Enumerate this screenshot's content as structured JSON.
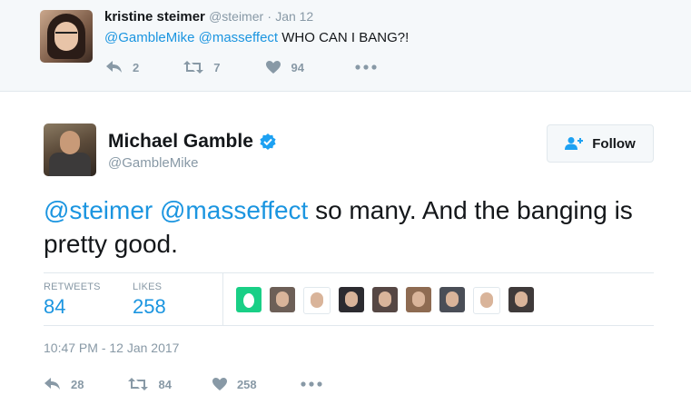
{
  "parent_tweet": {
    "name": "kristine steimer",
    "handle": "@steimer",
    "separator": "·",
    "date": "Jan 12",
    "mention1": "@GambleMike",
    "mention2": "@masseffect",
    "text": "WHO CAN I BANG?!",
    "replies": "2",
    "retweets": "7",
    "likes": "94"
  },
  "tweet": {
    "name": "Michael Gamble",
    "handle": "@GambleMike",
    "follow_label": "Follow",
    "mention1": "@steimer",
    "mention2": "@masseffect",
    "text": "so many. And the banging is pretty good.",
    "retweets_label": "RETWEETS",
    "retweets": "84",
    "likes_label": "LIKES",
    "likes": "258",
    "timestamp": "10:47 PM - 12 Jan 2017",
    "replies_count": "28",
    "retweets_count": "84",
    "likes_count": "258"
  },
  "colors": {
    "link": "#1b95e0",
    "muted": "#8899a6",
    "verified": "#1da1f2"
  },
  "likers": [
    {
      "bg": "#19cf86",
      "icon": "egg-icon"
    },
    {
      "bg": "#6d5f57",
      "icon": "avatar"
    },
    {
      "bg": "#ffffff",
      "icon": "avatar"
    },
    {
      "bg": "#2c2b30",
      "icon": "avatar"
    },
    {
      "bg": "#564744",
      "icon": "avatar"
    },
    {
      "bg": "#8e6b52",
      "icon": "avatar"
    },
    {
      "bg": "#4a4e57",
      "icon": "avatar"
    },
    {
      "bg": "#ffffff",
      "icon": "avatar"
    },
    {
      "bg": "#3f3a3a",
      "icon": "avatar"
    }
  ]
}
